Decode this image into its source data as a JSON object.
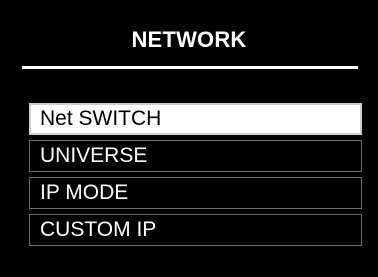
{
  "header": {
    "title": "NETWORK"
  },
  "menu": {
    "items": [
      {
        "label": "Net SWITCH",
        "selected": true
      },
      {
        "label": "UNIVERSE",
        "selected": false
      },
      {
        "label": "IP MODE",
        "selected": false
      },
      {
        "label": "CUSTOM IP",
        "selected": false
      }
    ]
  },
  "colors": {
    "background": "#000000",
    "foreground": "#ffffff",
    "highlight": "#ffffff",
    "highlight_text": "#000000"
  }
}
